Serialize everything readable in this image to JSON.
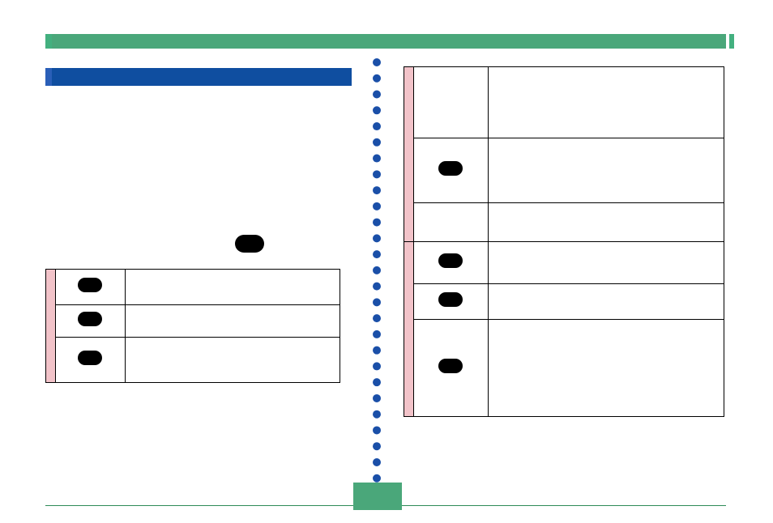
{
  "top_bar_title": "",
  "blue_bar_title": "",
  "left_center_label": "",
  "left_rows": [
    {
      "label": "",
      "content": ""
    },
    {
      "label": "",
      "content": ""
    },
    {
      "label": "",
      "content": ""
    }
  ],
  "right_rows": [
    {
      "label": "",
      "content": ""
    },
    {
      "label": "",
      "content": ""
    },
    {
      "label": "",
      "content": ""
    },
    {
      "label": "",
      "content": ""
    },
    {
      "label": "",
      "content": ""
    },
    {
      "label": "",
      "content": ""
    }
  ],
  "page_number": ""
}
